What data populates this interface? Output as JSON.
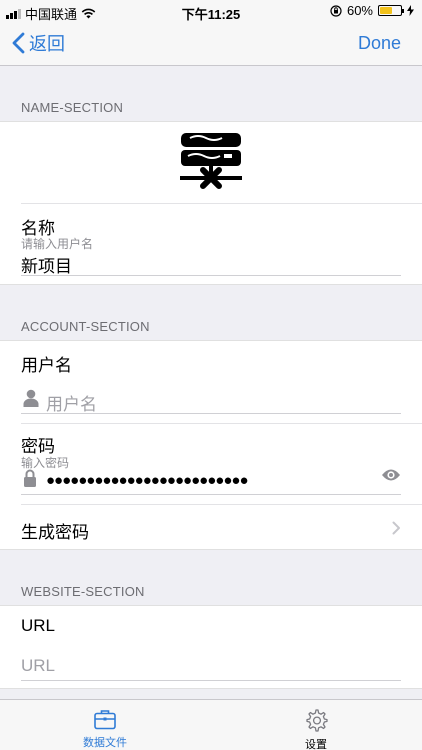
{
  "status": {
    "carrier": "中国联通",
    "time": "下午11:25",
    "battery_text": "60%",
    "battery_level": 0.6
  },
  "nav": {
    "back_label": "返回",
    "done_label": "Done"
  },
  "name_section": {
    "header": "NAME-SECTION",
    "name_label": "名称",
    "name_hint": "请输入用户名",
    "name_value": "新项目"
  },
  "account_section": {
    "header": "ACCOUNT-SECTION",
    "username_label": "用户名",
    "username_placeholder": "用户名",
    "password_label": "密码",
    "password_hint": "输入密码",
    "password_mask": "●●●●●●●●●●●●●●●●●●●●●●●●●",
    "generate_label": "生成密码"
  },
  "website_section": {
    "header": "WEBSITE-SECTION",
    "url_label": "URL",
    "url_placeholder": "URL"
  },
  "tabs": [
    {
      "label": "数据文件",
      "icon": "briefcase-icon",
      "active": true
    },
    {
      "label": "设置",
      "icon": "gear-icon",
      "active": false
    }
  ],
  "colors": {
    "accent": "#2f7bd6",
    "battery": "#f2c21b",
    "background": "#efeff4"
  }
}
